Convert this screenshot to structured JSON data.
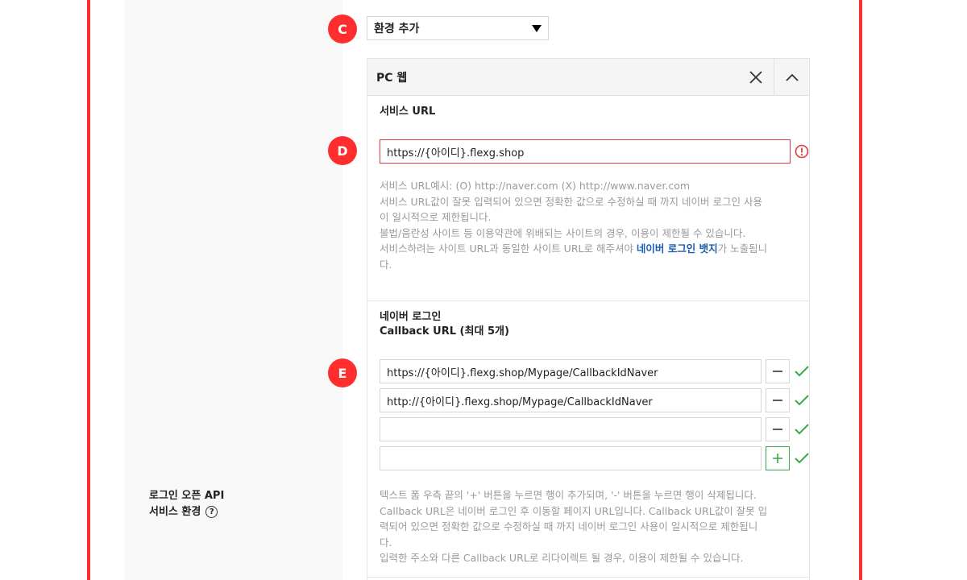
{
  "markers": {
    "c": "C",
    "d": "D",
    "e": "E"
  },
  "environment_select": {
    "value": "환경 추가"
  },
  "platform_panel": {
    "title": "PC 웹"
  },
  "service_url": {
    "title": "서비스 URL",
    "value": "https://{아이디}.flexg.shop",
    "help_line1": "서비스 URL예시: (O) http://naver.com (X) http://www.naver.com",
    "help_line2": "서비스 URL값이 잘못 입력되어 있으면 정확한 값으로 수정하실 때 까지 네이버 로그인 사용",
    "help_line3": "이 일시적으로 제한됩니다.",
    "help_line4": "불법/음란성 사이트 등 이용약관에 위배되는 사이트의 경우, 이용이 제한될 수 있습니다.",
    "help_line5_pre": "서비스하려는 사이트 URL과 동일한 사이트 URL로 해주셔야 ",
    "help_line5_link": "네이버 로그인 뱃지",
    "help_line5_post": "가 노출됩니",
    "help_line6": "다."
  },
  "callback": {
    "title_line1": "네이버 로그인",
    "title_line2": "Callback URL (최대 5개)",
    "urls": [
      "https://{아이디}.flexg.shop/Mypage/CallbackIdNaver",
      "http://{아이디}.flexg.shop/Mypage/CallbackIdNaver",
      "",
      ""
    ],
    "help_line1": "텍스트 폼 우측 끝의 '+' 버튼을 누르면 행이 추가되며, '-' 버튼을 누르면 행이 삭제됩니다.",
    "help_line2": "Callback URL은 네이버 로그인 후 이동할 페이지 URL입니다. Callback URL값이 잘못 입",
    "help_line3": "력되어 있으면 정확한 값으로 수정하실 때 까지 네이버 로그인 사용이 일시적으로 제한됩니",
    "help_line4": "다.",
    "help_line5": "입력한 주소와 다른 Callback URL로 리다이렉트 될 경우, 이용이 제한될 수 있습니다."
  },
  "side": {
    "label_line1": "로그인 오픈 API",
    "label_line2": "서비스 환경",
    "help_icon": "?"
  },
  "colors": {
    "frame": "#ff2d2d",
    "error": "#e23b3b",
    "success": "#3aa84a",
    "link": "#1b5db0"
  }
}
